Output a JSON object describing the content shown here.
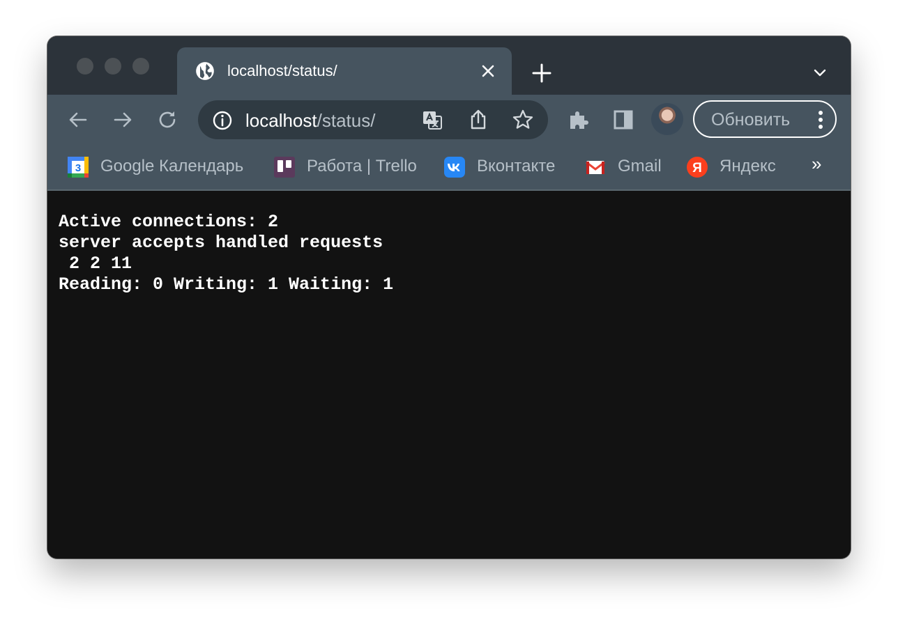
{
  "tab": {
    "title": "localhost/status/"
  },
  "address_bar": {
    "host": "localhost",
    "path": "/status/"
  },
  "update_button": {
    "label": "Обновить"
  },
  "bookmarks": [
    {
      "label": "Google Календарь",
      "icon": "google-calendar-icon"
    },
    {
      "label": "Работа | Trello",
      "icon": "trello-icon"
    },
    {
      "label": "Вконтакте",
      "icon": "vk-icon"
    },
    {
      "label": "Gmail",
      "icon": "gmail-icon"
    },
    {
      "label": "Яндекс",
      "icon": "yandex-icon"
    }
  ],
  "bookmarks_overflow": "»",
  "page": {
    "lines": [
      "Active connections: 2",
      "server accepts handled requests",
      " 2 2 11",
      "Reading: 0 Writing: 1 Waiting: 1"
    ]
  },
  "colors": {
    "tabbar": "#2c333a",
    "toolbar": "#46545f",
    "content_bg": "#121212",
    "text": "#ffffff"
  }
}
